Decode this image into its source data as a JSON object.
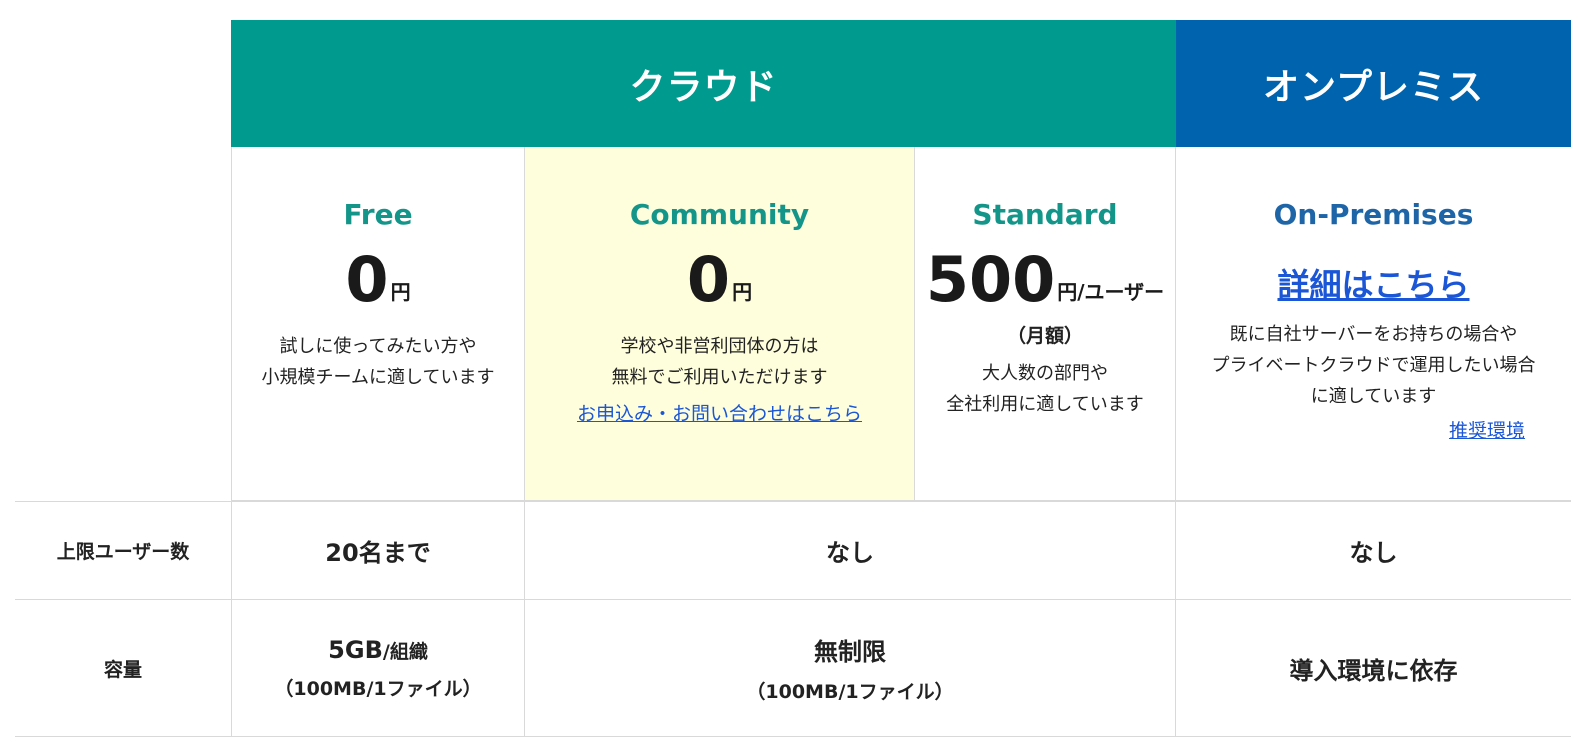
{
  "headers": {
    "cloud": "クラウド",
    "onprem": "オンプレミス"
  },
  "plans": {
    "free": {
      "name": "Free",
      "price": "0",
      "unit": "円",
      "desc": [
        "試しに使ってみたい方や",
        "小規模チームに適しています"
      ]
    },
    "community": {
      "name": "Community",
      "price": "0",
      "unit": "円",
      "desc": [
        "学校や非営利団体の方は",
        "無料でご利用いただけます"
      ],
      "link": "お申込み・お問い合わせはこちら"
    },
    "standard": {
      "name": "Standard",
      "price": "500",
      "unit": "円/ユーザー",
      "note": "（月額）",
      "desc": [
        "大人数の部門や",
        "全社利用に適しています"
      ]
    },
    "onprem": {
      "name": "On-Premises",
      "link": "詳細はこちら",
      "desc": [
        "既に自社サーバーをお持ちの場合や",
        "プライベートクラウドで運用したい場合",
        "に適しています"
      ],
      "env_link": "推奨環境"
    }
  },
  "rows": {
    "users": {
      "label": "上限ユーザー数",
      "free": "20名まで",
      "cloud": "なし",
      "onprem": "なし"
    },
    "capacity": {
      "label": "容量",
      "free_main": "5GB",
      "free_unit": "/組織",
      "free_sub": "（100MB/1ファイル）",
      "cloud_main": "無制限",
      "cloud_sub": "（100MB/1ファイル）",
      "onprem": "導入環境に依存"
    }
  },
  "colors": {
    "cloud_header": "#009a8f",
    "onprem_header": "#0063ad",
    "community_bg": "#fefedc",
    "link": "#1a56d6"
  }
}
